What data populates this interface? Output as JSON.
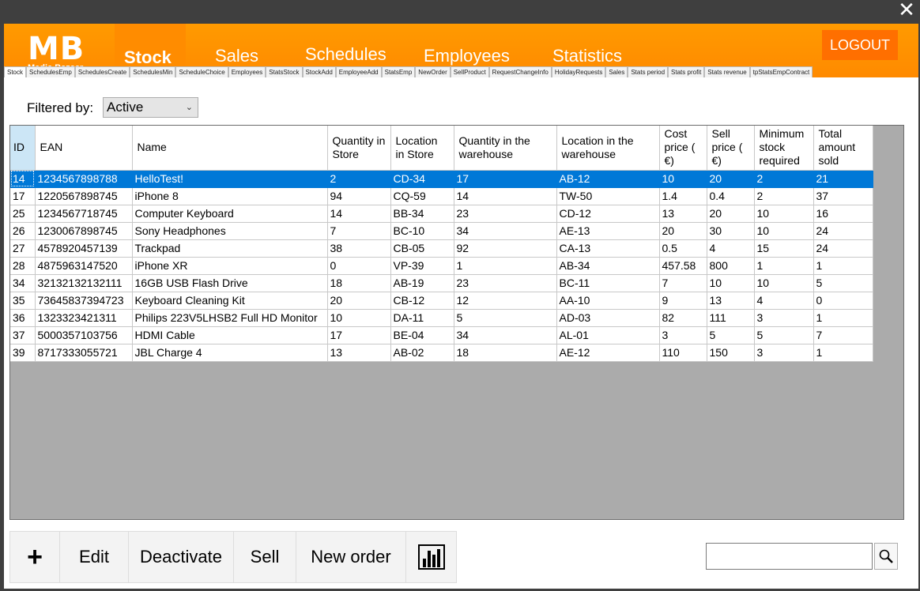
{
  "window": {
    "close_glyph": "✕"
  },
  "logo": {
    "mb": "MB",
    "sub": "Media Bazaar"
  },
  "nav": [
    {
      "label": "Stock"
    },
    {
      "label": "Sales"
    },
    {
      "label": "Schedules"
    },
    {
      "label": "Employees"
    },
    {
      "label": "Statistics"
    }
  ],
  "logout": "LOGOUT",
  "tabs": [
    "Stock",
    "SchedulesEmp",
    "SchedulesCreate",
    "SchedulesMin",
    "ScheduleChoice",
    "Employees",
    "StatsStock",
    "StockAdd",
    "EmployeeAdd",
    "StatsEmp",
    "NewOrder",
    "SellProduct",
    "RequestChangeInfo",
    "HolidayRequests",
    "Sales",
    "Stats period",
    "Stats profit",
    "Stats revenue",
    "tpStatsEmpContract"
  ],
  "filter": {
    "label": "Filtered by:",
    "value": "Active"
  },
  "table": {
    "headers": [
      "ID",
      "EAN",
      "Name",
      "Quantity in Store",
      "Location in Store",
      "Quantity in the warehouse",
      "Location in the warehouse",
      "Cost price ( €)",
      "Sell price ( €)",
      "Minimum stock required",
      "Total amount sold"
    ],
    "rows": [
      [
        "14",
        "1234567898788",
        "HelloTest!",
        "2",
        "CD-34",
        "17",
        "AB-12",
        "10",
        "20",
        "2",
        "21"
      ],
      [
        "17",
        "1220567898745",
        "iPhone 8",
        "94",
        "CQ-59",
        "14",
        "TW-50",
        "1.4",
        "0.4",
        "2",
        "37"
      ],
      [
        "25",
        "1234567718745",
        "Computer Keyboard",
        "14",
        "BB-34",
        "23",
        "CD-12",
        "13",
        "20",
        "10",
        "16"
      ],
      [
        "26",
        "1230067898745",
        "Sony Headphones",
        "7",
        "BC-10",
        "34",
        "AE-13",
        "20",
        "30",
        "10",
        "24"
      ],
      [
        "27",
        "4578920457139",
        "Trackpad",
        "38",
        "CB-05",
        "92",
        "CA-13",
        "0.5",
        "4",
        "15",
        "24"
      ],
      [
        "28",
        "4875963147520",
        "iPhone XR",
        "0",
        "VP-39",
        "1",
        "AB-34",
        "457.58",
        "800",
        "1",
        "1"
      ],
      [
        "34",
        "32132132132111",
        "16GB USB Flash Drive",
        "18",
        "AB-19",
        "23",
        "BC-11",
        "7",
        "10",
        "10",
        "5"
      ],
      [
        "35",
        "73645837394723",
        "Keyboard Cleaning Kit",
        "20",
        "CB-12",
        "12",
        "AA-10",
        "9",
        "13",
        "4",
        "0"
      ],
      [
        "36",
        "1323323421311",
        "Philips 223V5LHSB2 Full HD Monitor",
        "10",
        "DA-11",
        "5",
        "AD-03",
        "82",
        "111",
        "3",
        "1"
      ],
      [
        "37",
        "5000357103756",
        "HDMI Cable",
        "17",
        "BE-04",
        "34",
        "AL-01",
        "3",
        "5",
        "5",
        "7"
      ],
      [
        "39",
        "8717333055721",
        "JBL Charge 4",
        "13",
        "AB-02",
        "18",
        "AE-12",
        "110",
        "150",
        "3",
        "1"
      ]
    ]
  },
  "buttons": {
    "add": "+",
    "edit": "Edit",
    "deactivate": "Deactivate",
    "sell": "Sell",
    "new_order": "New order",
    "stats_icon": "bar-chart-icon"
  },
  "search": {
    "value": "",
    "icon": "magnifier-icon"
  },
  "colors": {
    "header": "#ff8c00",
    "selection": "#0078d7",
    "grid_bg": "#ababab"
  }
}
